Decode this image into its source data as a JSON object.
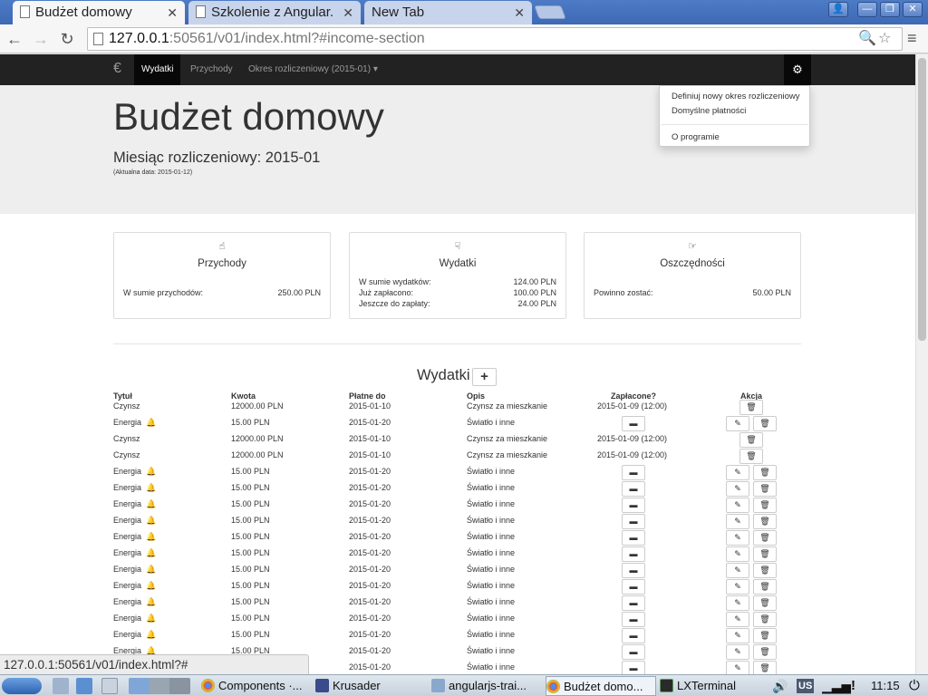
{
  "browser": {
    "tabs": [
      {
        "title": "Budżet domowy",
        "active": true
      },
      {
        "title": "Szkolenie z Angular.",
        "active": false
      },
      {
        "title": "New Tab",
        "active": false
      }
    ],
    "url_host": "127.0.0.1",
    "url_rest": ":50561/v01/index.html?#income-section",
    "status_url": "127.0.0.1:50561/v01/index.html?#"
  },
  "navbar": {
    "brand_icon": "€",
    "items": [
      "Wydatki",
      "Przychody",
      "Okres rozliczeniowy (2015-01) ▾"
    ],
    "active_item": "Wydatki",
    "gear_icon": "⚙"
  },
  "dropdown": {
    "items": [
      "Definiuj nowy okres rozliczeniowy",
      "Domyślne płatności",
      "O programie"
    ]
  },
  "header": {
    "title": "Budżet domowy",
    "subtitle": "Miesiąc rozliczeniowy: 2015-01",
    "current_date": "(Aktualna data: 2015-01-12)"
  },
  "panels": {
    "income": {
      "icon": "☝",
      "title": "Przychody",
      "rows": [
        {
          "label": "W sumie przychodów:",
          "value": "250.00 PLN"
        }
      ]
    },
    "expenses": {
      "icon": "☟",
      "title": "Wydatki",
      "rows": [
        {
          "label": "W sumie wydatków:",
          "value": "124.00 PLN"
        },
        {
          "label": "Już zapłacono:",
          "value": "100.00 PLN"
        },
        {
          "label": "Jeszcze do zapłaty:",
          "value": "24.00 PLN"
        }
      ]
    },
    "savings": {
      "icon": "☞",
      "title": "Oszczędności",
      "rows": [
        {
          "label": "Powinno zostać:",
          "value": "50.00 PLN"
        }
      ]
    }
  },
  "expenses_section": {
    "title": "Wydatki",
    "add_label": "+",
    "columns": [
      "Tytuł",
      "Kwota",
      "Płatne do",
      "Opis",
      "Zapłacone?",
      "Akcja"
    ],
    "rows": [
      {
        "title": "Czynsz",
        "bell": false,
        "amount": "12000.00 PLN",
        "due": "2015-01-10",
        "desc": "Czynsz za mieszkanie",
        "paid": "2015-01-09 (12:00)"
      },
      {
        "title": "Energia",
        "bell": true,
        "amount": "15.00 PLN",
        "due": "2015-01-20",
        "desc": "Światło i inne",
        "paid": ""
      },
      {
        "title": "Czynsz",
        "bell": false,
        "amount": "12000.00 PLN",
        "due": "2015-01-10",
        "desc": "Czynsz za mieszkanie",
        "paid": "2015-01-09 (12:00)"
      },
      {
        "title": "Czynsz",
        "bell": false,
        "amount": "12000.00 PLN",
        "due": "2015-01-10",
        "desc": "Czynsz za mieszkanie",
        "paid": "2015-01-09 (12:00)"
      },
      {
        "title": "Energia",
        "bell": true,
        "amount": "15.00 PLN",
        "due": "2015-01-20",
        "desc": "Światło i inne",
        "paid": ""
      },
      {
        "title": "Energia",
        "bell": true,
        "amount": "15.00 PLN",
        "due": "2015-01-20",
        "desc": "Światło i inne",
        "paid": ""
      },
      {
        "title": "Energia",
        "bell": true,
        "amount": "15.00 PLN",
        "due": "2015-01-20",
        "desc": "Światło i inne",
        "paid": ""
      },
      {
        "title": "Energia",
        "bell": true,
        "amount": "15.00 PLN",
        "due": "2015-01-20",
        "desc": "Światło i inne",
        "paid": ""
      },
      {
        "title": "Energia",
        "bell": true,
        "amount": "15.00 PLN",
        "due": "2015-01-20",
        "desc": "Światło i inne",
        "paid": ""
      },
      {
        "title": "Energia",
        "bell": true,
        "amount": "15.00 PLN",
        "due": "2015-01-20",
        "desc": "Światło i inne",
        "paid": ""
      },
      {
        "title": "Energia",
        "bell": true,
        "amount": "15.00 PLN",
        "due": "2015-01-20",
        "desc": "Światło i inne",
        "paid": ""
      },
      {
        "title": "Energia",
        "bell": true,
        "amount": "15.00 PLN",
        "due": "2015-01-20",
        "desc": "Światło i inne",
        "paid": ""
      },
      {
        "title": "Energia",
        "bell": true,
        "amount": "15.00 PLN",
        "due": "2015-01-20",
        "desc": "Światło i inne",
        "paid": ""
      },
      {
        "title": "Energia",
        "bell": true,
        "amount": "15.00 PLN",
        "due": "2015-01-20",
        "desc": "Światło i inne",
        "paid": ""
      },
      {
        "title": "Energia",
        "bell": true,
        "amount": "15.00 PLN",
        "due": "2015-01-20",
        "desc": "Światło i inne",
        "paid": ""
      },
      {
        "title": "Energia",
        "bell": true,
        "amount": "15.00 PLN",
        "due": "2015-01-20",
        "desc": "Światło i inne",
        "paid": ""
      },
      {
        "title": "Energia",
        "bell": true,
        "amount": "15.00 PLN",
        "due": "2015-01-20",
        "desc": "Światło i inne",
        "paid": ""
      }
    ]
  },
  "taskbar": {
    "apps": [
      "Components ·...",
      "Krusader",
      "angularjs-trai...",
      "Budżet domo...",
      "LXTerminal"
    ],
    "layout": "US",
    "clock": "11:15"
  },
  "colors": {
    "navbar_bg": "#222222",
    "jumbotron_bg": "#eeeeee",
    "tab_strip": "#4d7bc5"
  }
}
